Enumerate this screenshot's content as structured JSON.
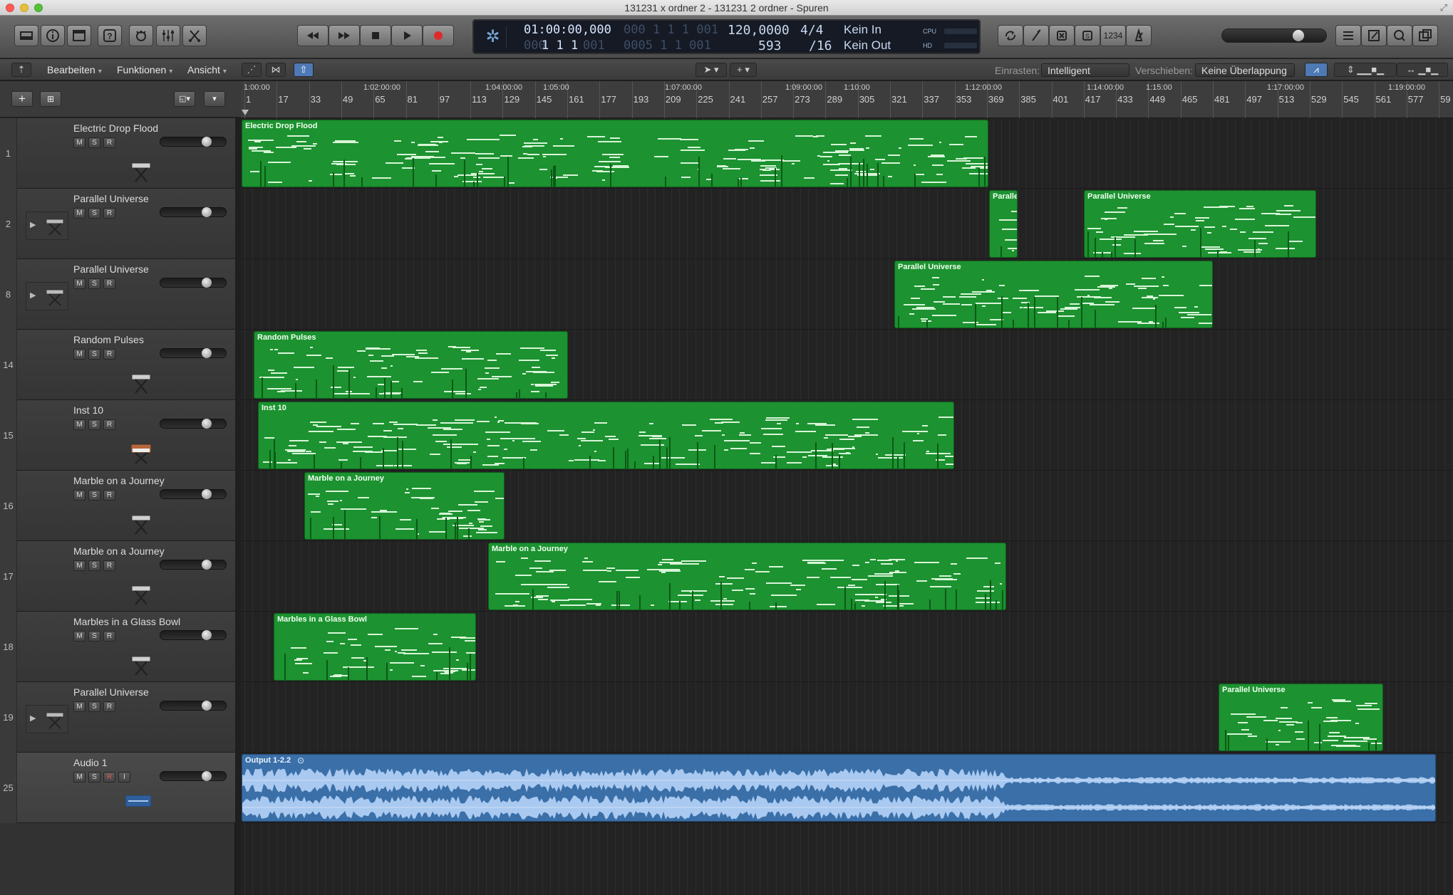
{
  "window": {
    "title": "131231 x ordner 2 - 131231 2 ordner - Spuren"
  },
  "lcd": {
    "time_position": "01:00:00,000",
    "time_dim_right": "000 1  1  1  001",
    "bar_position": "1  1  1",
    "bar_dim_left": "000",
    "bar_dim_right": "001",
    "bar_dim_mid": "0005  1  1  001",
    "tempo": "120,0000",
    "signature": "4/4",
    "division": "/16",
    "tempo_second_value": "593",
    "midi_in": "Kein In",
    "midi_out": "Kein Out",
    "cpu_label": "CPU",
    "hd_label": "HD"
  },
  "toolbar": {
    "count_in_label": "1234"
  },
  "menubar": {
    "edit": "Bearbeiten",
    "functions": "Funktionen",
    "view": "Ansicht",
    "snap_label": "Einrasten:",
    "snap_value": "Intelligent",
    "drag_label": "Verschieben:",
    "drag_value": "Keine Überlappung"
  },
  "ruler": {
    "times": [
      "1:00:00",
      "1:02:00:00",
      "1:04:00:00",
      "1:05:00",
      "1:07:00:00",
      "1:09:00:00",
      "1:10:00",
      "1:12:00:00",
      "1:14:00:00",
      "1:15:00",
      "1:17:00:00",
      "1:19:00:00"
    ],
    "bars": [
      "1",
      "17",
      "33",
      "49",
      "65",
      "81",
      "97",
      "113",
      "129",
      "145",
      "161",
      "177",
      "193",
      "209",
      "225",
      "241",
      "257",
      "273",
      "289",
      "305",
      "321",
      "337",
      "353",
      "369",
      "385",
      "401",
      "417",
      "433",
      "449",
      "465",
      "481",
      "497",
      "513",
      "529",
      "545",
      "561",
      "577",
      "59"
    ]
  },
  "tracks": [
    {
      "number": "1",
      "name": "Electric Drop Flood",
      "msr": [
        "M",
        "S",
        "R"
      ]
    },
    {
      "number": "2",
      "name": "Parallel Universe",
      "msr": [
        "M",
        "S",
        "R"
      ]
    },
    {
      "number": "8",
      "name": "Parallel Universe",
      "msr": [
        "M",
        "S",
        "R"
      ]
    },
    {
      "number": "14",
      "name": "Random Pulses",
      "msr": [
        "M",
        "S",
        "R"
      ]
    },
    {
      "number": "15",
      "name": "Inst 10",
      "msr": [
        "M",
        "S",
        "R"
      ]
    },
    {
      "number": "16",
      "name": "Marble on a Journey",
      "msr": [
        "M",
        "S",
        "R"
      ]
    },
    {
      "number": "17",
      "name": "Marble on a Journey",
      "msr": [
        "M",
        "S",
        "R"
      ]
    },
    {
      "number": "18",
      "name": "Marbles in a Glass Bowl",
      "msr": [
        "M",
        "S",
        "R"
      ]
    },
    {
      "number": "19",
      "name": "Parallel Universe",
      "msr": [
        "M",
        "S",
        "R"
      ]
    },
    {
      "number": "25",
      "name": "Audio 1",
      "msr": [
        "M",
        "S",
        "R",
        "I"
      ]
    }
  ],
  "regions": [
    {
      "name": "Electric Drop Flood",
      "lane": 0
    },
    {
      "name": "Paralle",
      "lane": 1
    },
    {
      "name": "Parallel Universe",
      "lane": 1
    },
    {
      "name": "Parallel Universe",
      "lane": 2
    },
    {
      "name": "Random Pulses",
      "lane": 3
    },
    {
      "name": "Inst 10",
      "lane": 4
    },
    {
      "name": "Marble on a Journey",
      "lane": 5
    },
    {
      "name": "Marble on a Journey",
      "lane": 6
    },
    {
      "name": "Marbles in a Glass Bowl",
      "lane": 7
    },
    {
      "name": "Parallel Universe",
      "lane": 8
    },
    {
      "name": "Output 1-2.2",
      "lane": 9
    }
  ],
  "colors": {
    "midi_region": "#1c9230",
    "audio_region": "#3a6fa8",
    "waveform": "#a9c9f0"
  }
}
